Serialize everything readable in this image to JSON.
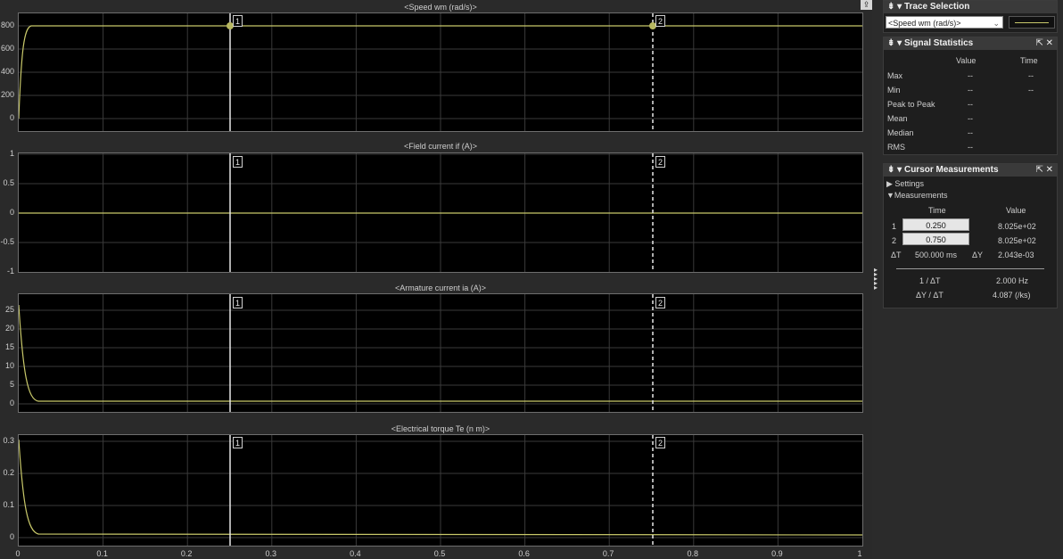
{
  "plots": [
    {
      "title": "<Speed wm (rad/s)>",
      "yticks": [
        "800",
        "600",
        "400",
        "200",
        "0"
      ]
    },
    {
      "title": "<Field current if (A)>",
      "yticks": [
        "1",
        "0.5",
        "0",
        "-0.5",
        "-1"
      ]
    },
    {
      "title": "<Armature current ia (A)>",
      "yticks": [
        "25",
        "20",
        "15",
        "10",
        "5",
        "0"
      ]
    },
    {
      "title": "<Electrical torque Te (n m)>",
      "yticks": [
        "0.3",
        "0.2",
        "0.1",
        "0"
      ]
    }
  ],
  "xticks": [
    "0",
    "0.1",
    "0.2",
    "0.3",
    "0.4",
    "0.5",
    "0.6",
    "0.7",
    "0.8",
    "0.9",
    "1"
  ],
  "cursor_labels": {
    "c1": "1",
    "c2": "2"
  },
  "trace_selection": {
    "title": "Trace Selection",
    "selected": "<Speed wm (rad/s)>",
    "line_color": "#c8c86a"
  },
  "signal_statistics": {
    "title": "Signal Statistics",
    "col_value": "Value",
    "col_time": "Time",
    "rows": [
      {
        "label": "Max",
        "value": "--",
        "time": "--"
      },
      {
        "label": "Min",
        "value": "--",
        "time": "--"
      },
      {
        "label": "Peak to Peak",
        "value": "--",
        "time": ""
      },
      {
        "label": "Mean",
        "value": "--",
        "time": ""
      },
      {
        "label": "Median",
        "value": "--",
        "time": ""
      },
      {
        "label": "RMS",
        "value": "--",
        "time": ""
      }
    ]
  },
  "cursor_measurements": {
    "title": "Cursor Measurements",
    "settings": "Settings",
    "measurements": "Measurements",
    "col_time": "Time",
    "col_value": "Value",
    "c1": {
      "id": "1",
      "time": "0.250",
      "value": "8.025e+02"
    },
    "c2": {
      "id": "2",
      "time": "0.750",
      "value": "8.025e+02"
    },
    "dt_label": "ΔT",
    "dt_value": "500.000 ms",
    "dy_label": "ΔY",
    "dy_value": "2.043e-03",
    "inv_label": "1 / ΔT",
    "inv_value": "2.000 Hz",
    "slope_label": "ΔY / ΔT",
    "slope_value": "4.087 (/ks)"
  },
  "icons": {
    "float": "undock-icon",
    "panel_controls": "pin-undock-close-icons"
  }
}
